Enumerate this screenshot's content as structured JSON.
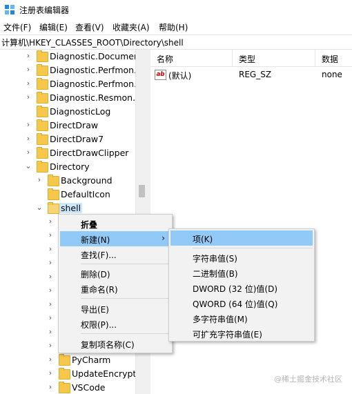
{
  "window": {
    "title": "注册表编辑器",
    "accent_color": "#0078d7"
  },
  "menu": [
    "文件(F)",
    "编辑(E)",
    "查看(V)",
    "收藏夹(A)",
    "帮助(H)"
  ],
  "address": "计算机\\HKEY_CLASSES_ROOT\\Directory\\shell",
  "tree": {
    "items_top": [
      {
        "label": "Diagnostic.Document"
      },
      {
        "label": "Diagnostic.Perfmon.C"
      },
      {
        "label": "Diagnostic.Perfmon.D"
      },
      {
        "label": "Diagnostic.Resmon.C"
      },
      {
        "label": "DiagnosticLog"
      },
      {
        "label": "DirectDraw"
      },
      {
        "label": "DirectDraw7"
      },
      {
        "label": "DirectDrawClipper"
      },
      {
        "label": "Directory"
      },
      {
        "label": "Background"
      },
      {
        "label": "DefaultIcon"
      },
      {
        "label": "shell"
      }
    ],
    "items_bottom": [
      {
        "label": "PyCharm"
      },
      {
        "label": "UpdateEncryptio"
      },
      {
        "label": "VSCode"
      }
    ]
  },
  "list": {
    "headers": [
      "名称",
      "类型",
      "数据"
    ],
    "rows": [
      {
        "name": "(默认)",
        "type": "REG_SZ",
        "data": "none",
        "icon": "string-value-icon"
      }
    ]
  },
  "context_menu": {
    "items": [
      "折叠",
      "新建(N)",
      "查找(F)...",
      "删除(D)",
      "重命名(R)",
      "导出(E)",
      "权限(P)...",
      "复制项名称(C)"
    ],
    "highlight_color": "#91c9f7"
  },
  "submenu": {
    "items": [
      "项(K)",
      "字符串值(S)",
      "二进制值(B)",
      "DWORD (32 位)值(D)",
      "QWORD (64 位)值(Q)",
      "多字符串值(M)",
      "可扩充字符串值(E)"
    ]
  },
  "watermark": "@稀土掘金技术社区"
}
